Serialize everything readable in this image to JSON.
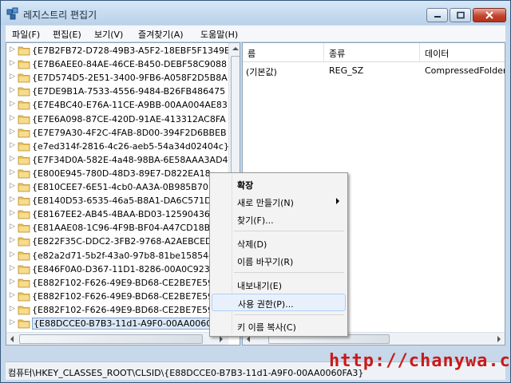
{
  "window": {
    "title": "레지스트리 편집기"
  },
  "menubar": [
    "파일(F)",
    "편집(E)",
    "보기(V)",
    "즐겨찾기(A)",
    "도움말(H)"
  ],
  "tree": {
    "items": [
      "{E7B2FB72-D728-49B3-A5F2-18EBF5F1349E",
      "{E7B6AEE0-84AE-46CE-B450-DEBF58C9088",
      "{E7D574D5-2E51-3400-9FB6-A058F2D5B8A",
      "{E7DE9B1A-7533-4556-9484-B26FB486475",
      "{E7E4BC40-E76A-11CE-A9BB-00AA004AE83",
      "{E7E6A098-87CE-420D-91AE-413312AC8FA",
      "{E7E79A30-4F2C-4FAB-8D00-394F2D6BBEB",
      "{e7ed314f-2816-4c26-aeb5-54a34d02404c}",
      "{E7F34D0A-582E-4a48-98BA-6E58AAA3AD4",
      "{E800E945-780D-48D3-89E7-D822EA18",
      "{E810CEE7-6E51-4cb0-AA3A-0B985B70",
      "{E8140D53-6535-46a5-B8A1-DA6C571D",
      "{E8167EE2-AB45-4BAA-BD03-12590436",
      "{E81AAE08-1C96-4F9B-BF04-A47CD18B",
      "{E822F35C-DDC2-3FB2-9768-A2AEBCED",
      "{e82a2d71-5b2f-43a0-97b8-81be15854c",
      "{E846F0A0-D367-11D1-8286-00A0C923",
      "{E882F102-F626-49E9-BD68-CE2BE7E59",
      "{E882F102-F626-49E9-BD68-CE2BE7E59",
      "{E882F102-F626-49E9-BD68-CE2BE7E59",
      "{E88DCCE0-B7B3-11d1-A9F0-00AA0060FA3"
    ],
    "selected_index": 20
  },
  "list": {
    "headers": [
      "름",
      "종류",
      "데이터"
    ],
    "row": {
      "name": "(기본값)",
      "type": "REG_SZ",
      "data": "CompressedFolder"
    }
  },
  "context_menu": {
    "items": [
      "확장",
      "새로 만들기(N)",
      "찾기(F)...",
      "삭제(D)",
      "이름 바꾸기(R)",
      "내보내기(E)",
      "사용 권한(P)...",
      "키 이름 복사(C)"
    ]
  },
  "statusbar": {
    "path": "컴퓨터\\HKEY_CLASSES_ROOT\\CLSID\\{E88DCCE0-B7B3-11d1-A9F0-00AA0060FA3}"
  },
  "watermark": "http://chanywa.com",
  "colors": {
    "folder": "#e9c35a",
    "highlight": "#dbe8f7",
    "watermark": "#c91a1a"
  }
}
